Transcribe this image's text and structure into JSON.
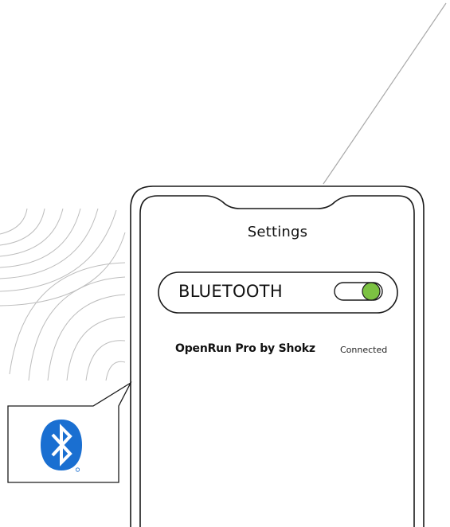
{
  "screen": {
    "title": "Settings"
  },
  "bluetooth": {
    "label": "BLUETOOTH",
    "enabled": true,
    "toggle_color": "#7cc242"
  },
  "paired_device": {
    "name": "OpenRun Pro by Shokz",
    "status": "Connected"
  },
  "callout": {
    "icon": "bluetooth-logo-icon",
    "logo_color": "#1a6fd1"
  }
}
